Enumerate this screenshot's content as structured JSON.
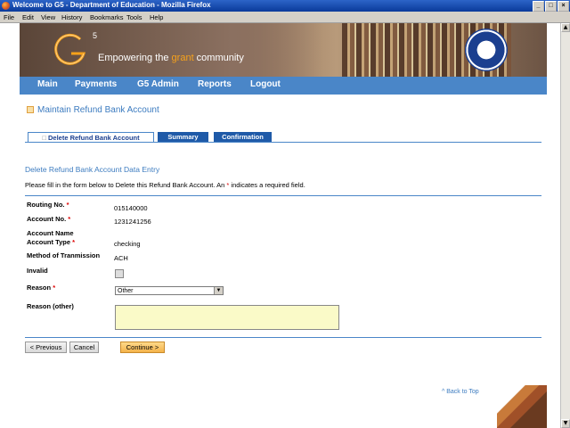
{
  "window": {
    "title": "Welcome to G5 - Department of Education - Mozilla Firefox",
    "min": "_",
    "max": "□",
    "close": "×"
  },
  "menu": [
    "File",
    "Edit",
    "View",
    "History",
    "Bookmarks",
    "Tools",
    "Help"
  ],
  "banner": {
    "logo_super": "5",
    "tagline_pre": "Empowering the ",
    "tagline_hl": "grant",
    "tagline_post": " community"
  },
  "nav": [
    "Main",
    "Payments",
    "G5 Admin",
    "Reports",
    "Logout"
  ],
  "page_title": "Maintain Refund Bank Account",
  "tabs": [
    "Delete Refund Bank Account",
    "Summary",
    "Confirmation"
  ],
  "section": {
    "heading": "Delete Refund Bank Account Data Entry",
    "instr_pre": "Please fill in the form below to Delete this Refund Bank Account. An ",
    "instr_star": "*",
    "instr_post": " indicates a required field."
  },
  "fields": {
    "routing_label": "Routing No.",
    "routing_value": "015140000",
    "account_no_label": "Account No.",
    "account_no_value": "1231241256",
    "account_name_label": "Account Name",
    "account_type_label": "Account Type",
    "account_type_value": "checking",
    "method_label": "Method of Tranmission",
    "method_value": "ACH",
    "invalid_label": "Invalid",
    "reason_label": "Reason",
    "reason_value": "Other",
    "reason_other_label": "Reason (other)",
    "req_mark": "*"
  },
  "buttons": {
    "previous": "< Previous",
    "cancel": "Cancel",
    "continue": "Continue >"
  },
  "back_to_top": "^ Back to Top",
  "colors": {
    "nav": "#4a86c8",
    "accent": "#f7a21b",
    "tab_active_text": "#1b3f8f"
  }
}
